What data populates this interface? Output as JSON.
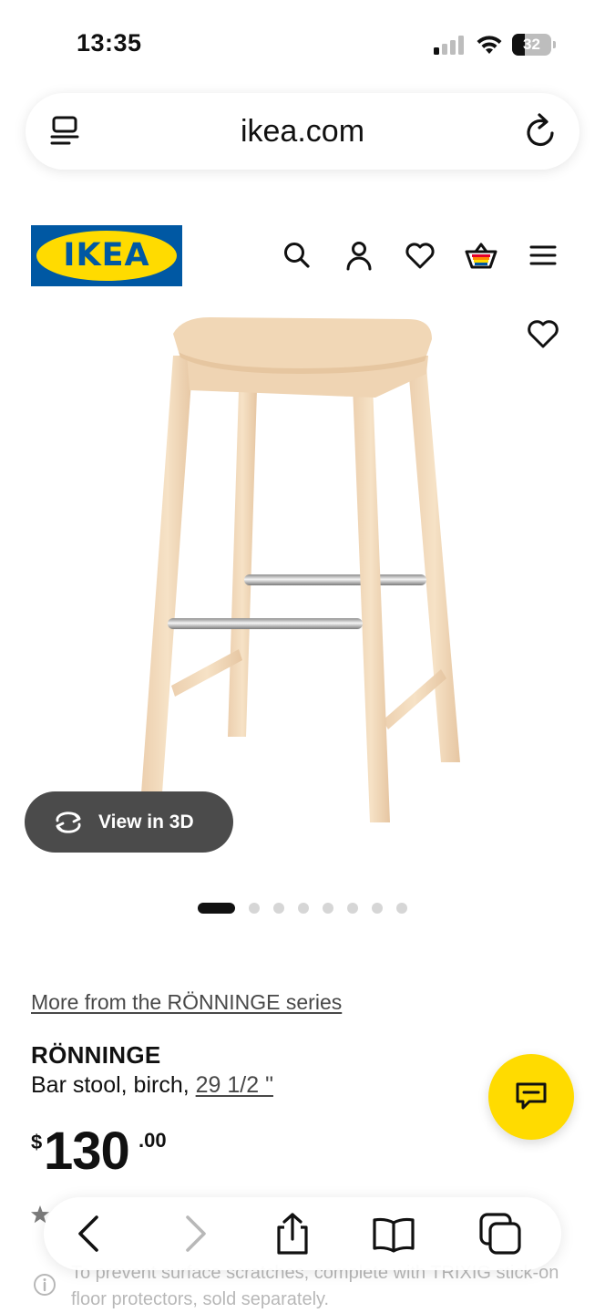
{
  "status_bar": {
    "time": "13:35",
    "battery": "32",
    "battery_level": 0.32
  },
  "browser": {
    "url": "ikea.com"
  },
  "site_header": {
    "logo_text": "IKEA",
    "brand_colors": {
      "blue": "#0058a3",
      "yellow": "#ffdb00"
    },
    "icons": [
      "search-icon",
      "account-icon",
      "heart-icon",
      "cart-icon",
      "menu-icon"
    ]
  },
  "product_image": {
    "view_3d_label": "View in 3D",
    "carousel": {
      "total": 8,
      "active": 1
    }
  },
  "product": {
    "series_link": "More from the RÖNNINGE series",
    "name": "RÖNNINGE",
    "description": "Bar stool, birch, ",
    "size_link": "29 1/2 \"",
    "price": {
      "currency": "$",
      "integer": "130",
      "decimal": ".00"
    }
  },
  "info_note": {
    "text": "To prevent surface scratches, complete with TRIXIG stick-on floor protectors, sold separately."
  },
  "toolbar": {
    "icons": [
      "back-icon",
      "forward-icon",
      "share-icon",
      "bookmarks-icon",
      "tabs-icon"
    ]
  }
}
